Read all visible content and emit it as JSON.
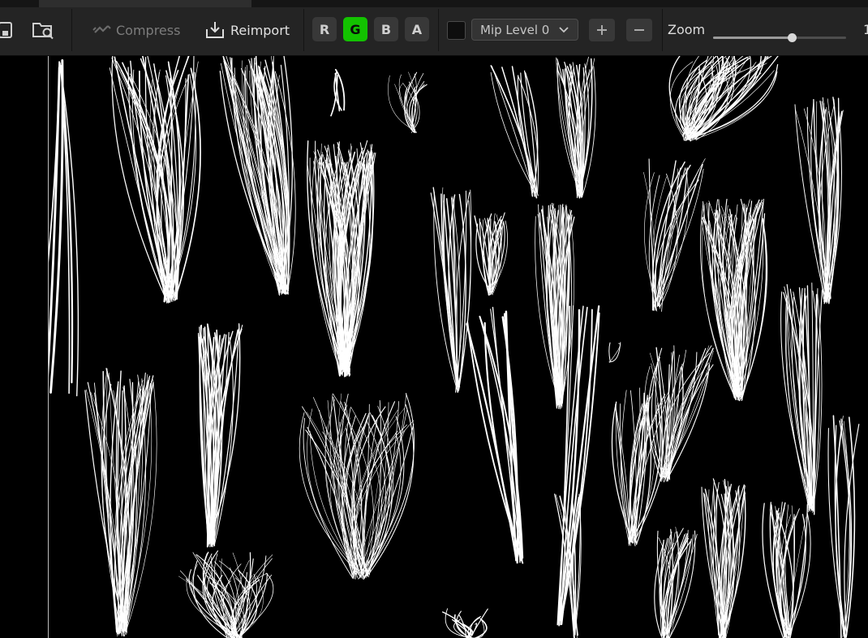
{
  "toolbar": {
    "compress_label": "Compress",
    "reimport_label": "Reimport",
    "channels": [
      {
        "label": "R",
        "active": false
      },
      {
        "label": "G",
        "active": true
      },
      {
        "label": "B",
        "active": false
      },
      {
        "label": "A",
        "active": false
      }
    ],
    "mip_level": "Mip Level 0",
    "zoom_label": "Zoom",
    "zoom_value": "1",
    "zoom_level_fraction": 0.59,
    "active_channel_color": "#13c200"
  },
  "icons": {
    "save": "save-icon",
    "browse": "browse-folder-icon",
    "compress": "compress-icon",
    "reimport": "reimport-icon",
    "plus": "plus-icon",
    "minus": "minus-icon",
    "chevron": "chevron-down-icon"
  }
}
